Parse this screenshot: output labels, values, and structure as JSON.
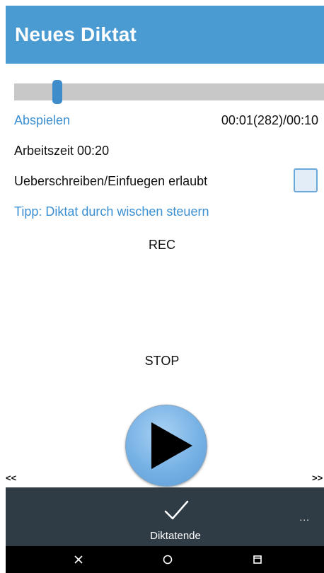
{
  "header": {
    "title": "Neues Diktat"
  },
  "player": {
    "play_label": "Abspielen",
    "time_display": "00:01(282)/00:10",
    "position_fraction": 0.1
  },
  "info": {
    "work_time": "Arbeitszeit 00:20",
    "overwrite_label": "Ueberschreiben/Einfuegen erlaubt",
    "overwrite_checked": false,
    "tip": "Tipp: Diktat durch wischen steuern"
  },
  "controls": {
    "rec_label": "REC",
    "stop_label": "STOP",
    "prev_label": "<<",
    "next_label": ">>"
  },
  "action_bar": {
    "done_label": "Diktatende",
    "more_label": "..."
  },
  "icons": {
    "play": "play-icon",
    "done": "checkmark-icon",
    "close": "close-icon",
    "home": "home-icon",
    "recent": "recent-apps-icon"
  },
  "colors": {
    "header_bg": "#4b9bd3",
    "accent": "#3b8fd1",
    "action_bar_bg": "#2f3b45",
    "seek_track": "#c8c8c8",
    "seek_thumb": "#3f8ccb"
  }
}
